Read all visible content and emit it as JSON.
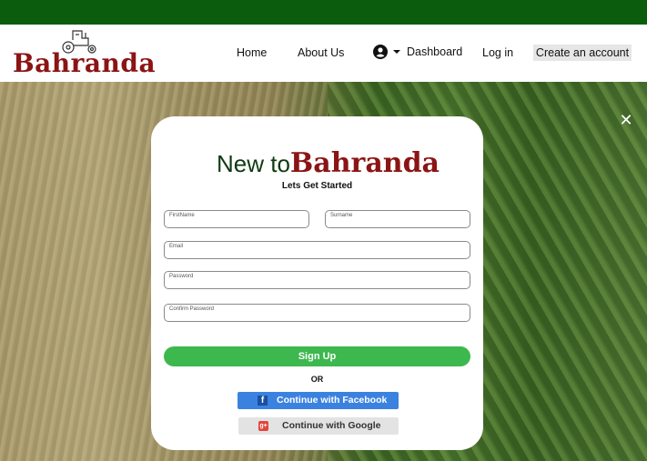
{
  "brand": {
    "name": "Bahranda"
  },
  "nav": {
    "home": "Home",
    "about": "About Us",
    "dashboard": "Dashboard",
    "login": "Log in",
    "create": "Create an account"
  },
  "modal": {
    "title_prefix": "New to",
    "title_brand": "Bahranda",
    "subtitle": "Lets Get Started",
    "fields": {
      "firstname": "FirstName",
      "surname": "Surname",
      "email": "Email",
      "password": "Password",
      "confirm": "Confirm Password"
    },
    "signup": "Sign Up",
    "or": "OR",
    "facebook": "Continue with Facebook",
    "google": "Continue with Google",
    "facebook_glyph": "f",
    "google_glyph": "g+",
    "close_glyph": "✕"
  },
  "colors": {
    "topbar": "#0b5c0c",
    "brand": "#8b1414",
    "signup": "#3db84e",
    "facebook": "#3b82e0",
    "google": "#e3e3e3"
  },
  "icons": [
    "tractor-icon",
    "user-circle-icon",
    "caret-down-icon",
    "close-icon",
    "facebook-icon",
    "google-plus-icon"
  ]
}
